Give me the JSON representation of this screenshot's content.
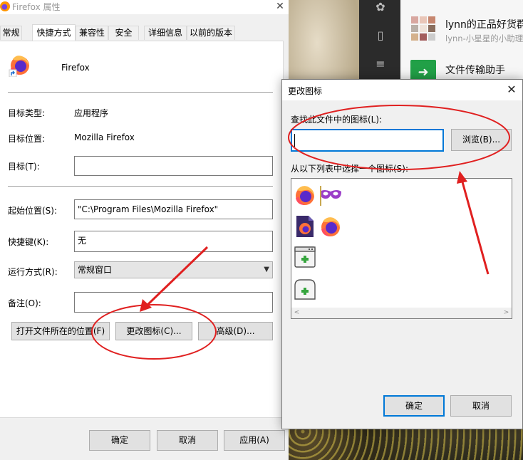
{
  "background": {
    "chats": [
      {
        "name": "lynn的正品好货群",
        "sub": "lynn-小星星的小助理"
      },
      {
        "name": "文件传输助手",
        "sub": ""
      }
    ]
  },
  "props_dialog": {
    "title": "Firefox 属性",
    "tabs": [
      "常规",
      "快捷方式",
      "兼容性",
      "安全",
      "详细信息",
      "以前的版本"
    ],
    "active_tab": "快捷方式",
    "app_name": "Firefox",
    "fields": {
      "target_type_label": "目标类型:",
      "target_type_value": "应用程序",
      "target_location_label": "目标位置:",
      "target_location_value": "Mozilla Firefox",
      "target_label": "目标(T):",
      "target_value": "",
      "start_in_label": "起始位置(S):",
      "start_in_value": "\"C:\\Program Files\\Mozilla Firefox\"",
      "hotkey_label": "快捷键(K):",
      "hotkey_value": "无",
      "run_label": "运行方式(R):",
      "run_value": "常规窗口",
      "comment_label": "备注(O):",
      "comment_value": ""
    },
    "buttons": {
      "open_location": "打开文件所在的位置(F)",
      "change_icon": "更改图标(C)...",
      "advanced": "高级(D)...",
      "ok": "确定",
      "cancel": "取消",
      "apply": "应用(A)"
    }
  },
  "change_icon_dialog": {
    "title": "更改图标",
    "find_label": "查找此文件中的图标(L):",
    "path_value": "",
    "browse": "浏览(B)...",
    "list_label": "从以下列表中选择一个图标(S):",
    "ok": "确定",
    "cancel": "取消"
  },
  "colors": {
    "accent": "#0078d7",
    "annotation_red": "#e02020"
  }
}
